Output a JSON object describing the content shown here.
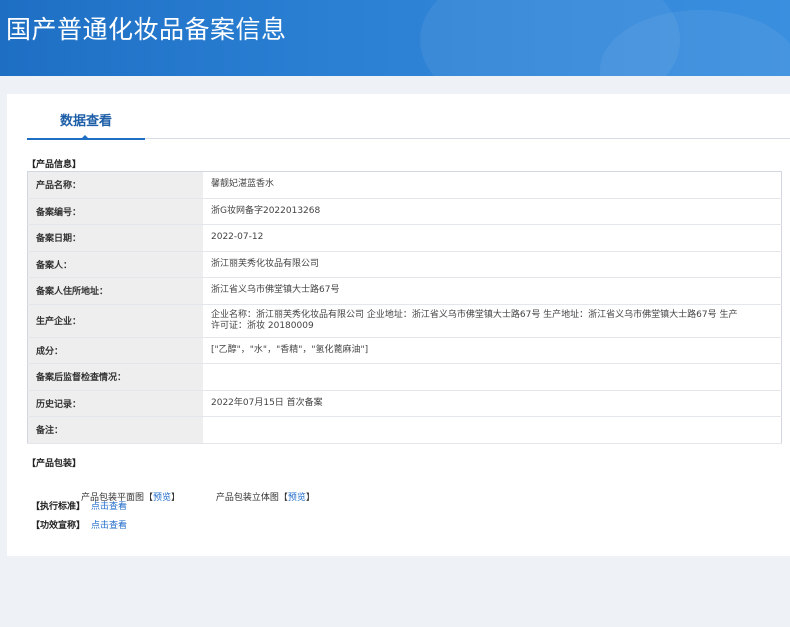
{
  "header": {
    "title": "国产普通化妆品备案信息"
  },
  "tabs": [
    {
      "label": "数据查看"
    }
  ],
  "product_info": {
    "section_label": "【产品信息】",
    "rows": [
      {
        "key": "产品名称：",
        "value": "馨靓妃湛蓝香水"
      },
      {
        "key": "备案编号：",
        "value": "浙G妆网备字2022013268"
      },
      {
        "key": "备案日期：",
        "value": "2022-07-12"
      },
      {
        "key": "备案人：",
        "value": "浙江丽芙秀化妆品有限公司"
      },
      {
        "key": "备案人住所地址：",
        "value": "浙江省义乌市佛堂镇大士路67号"
      },
      {
        "key": "生产企业：",
        "value": "企业名称：浙江丽芙秀化妆品有限公司 企业地址：浙江省义乌市佛堂镇大士路67号 生产地址：浙江省义乌市佛堂镇大士路67号 生产许可证：浙妆 20180009"
      },
      {
        "key": "成分：",
        "value": "[\"乙醇\"，\"水\"，\"香精\"，\"氢化蓖麻油\"]"
      },
      {
        "key": "备案后监督检查情况：",
        "value": ""
      },
      {
        "key": "历史记录：",
        "value": "2022年07月15日 首次备案"
      },
      {
        "key": "备注：",
        "value": ""
      }
    ]
  },
  "packaging": {
    "section_label": "【产品包装】",
    "flat_label": "产品包装平面图",
    "flat_link": "预览",
    "solid_label": "产品包装立体图",
    "solid_link": "预览",
    "bracket_open": "【",
    "bracket_close": "】"
  },
  "standard": {
    "label": "【执行标准】",
    "link": "点击查看"
  },
  "efficacy": {
    "label": "【功效宣称】",
    "link": "点击查看"
  },
  "colors": {
    "banner": "#1e6fc4",
    "link": "#1f6bc9",
    "key_bg": "#eeeeee"
  }
}
